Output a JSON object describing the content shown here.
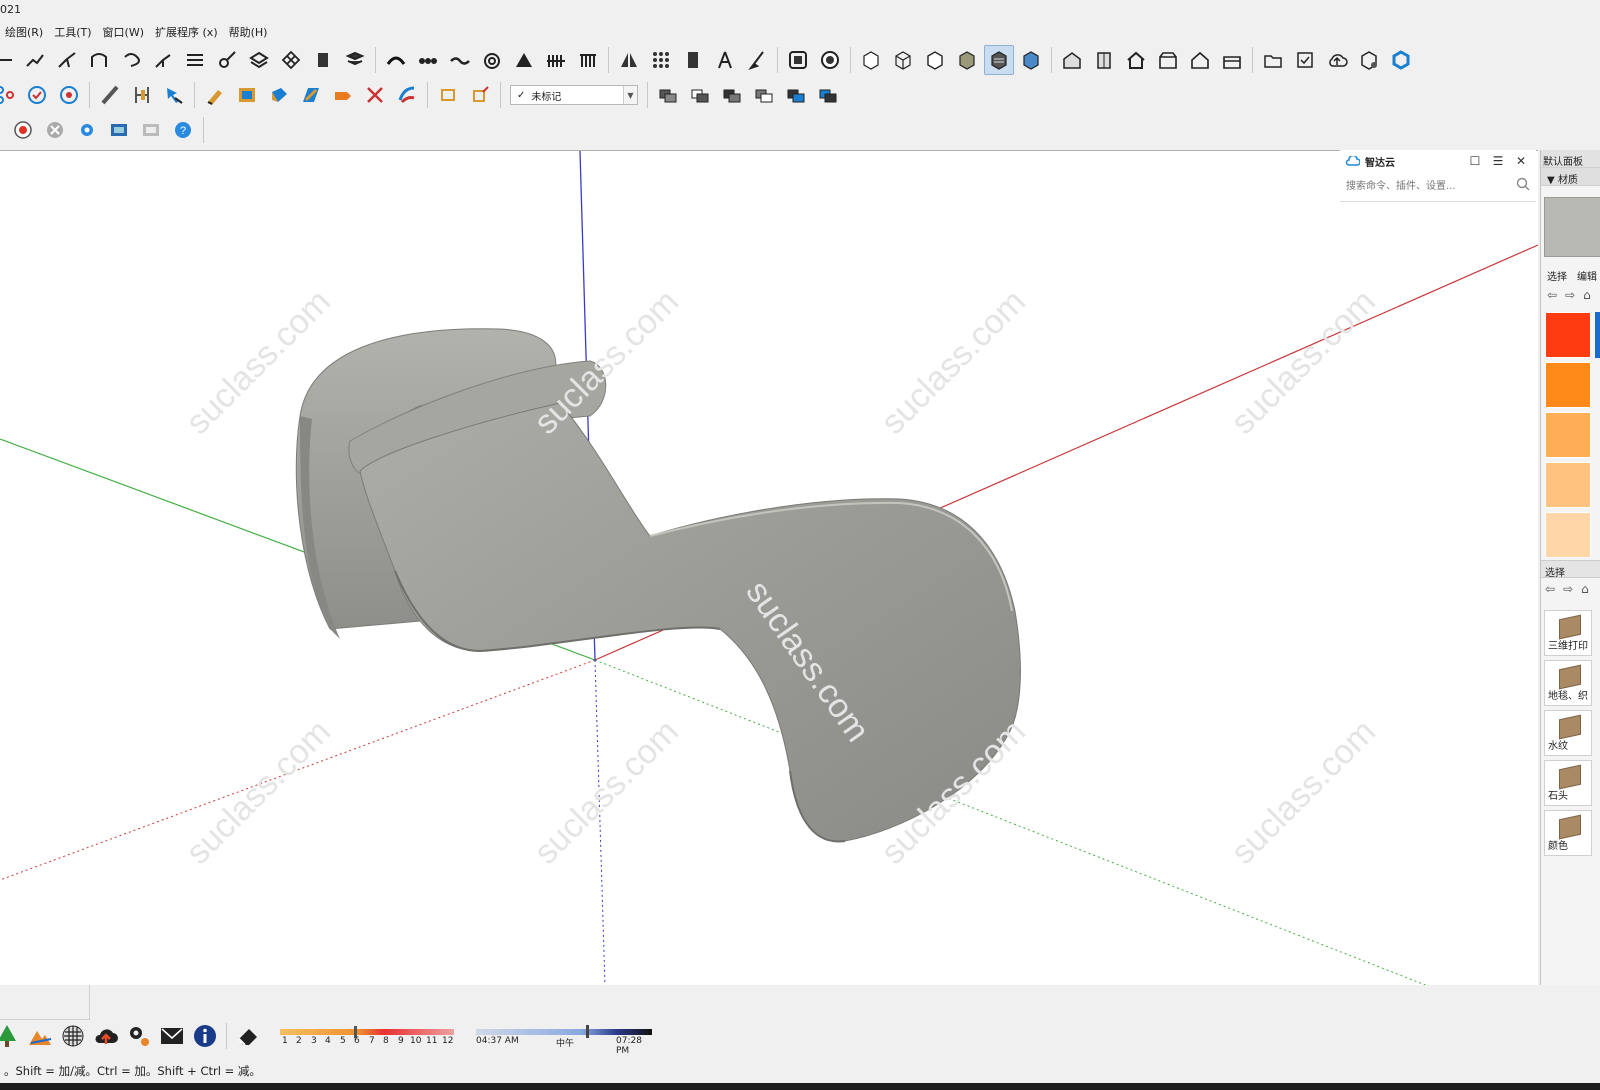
{
  "window": {
    "title_fragment": "021"
  },
  "menu": [
    "绘图(R)",
    "工具(T)",
    "窗口(W)",
    "扩展程序 (x)",
    "帮助(H)"
  ],
  "tag_dropdown": {
    "value": "未标记",
    "check": "✓"
  },
  "plugin": {
    "name": "智达云",
    "search_placeholder": "搜索命令、插件、设置..."
  },
  "default_panel": {
    "title": "默认面板",
    "section": "▼ 材质",
    "tab_select": "选择",
    "tab_edit": "编辑",
    "section2": "选择"
  },
  "materials": [
    {
      "label": "三维打印"
    },
    {
      "label": "地毯、织"
    },
    {
      "label": "水纹"
    },
    {
      "label": "石头"
    },
    {
      "label": "颜色"
    }
  ],
  "color_swatches": [
    "#ff3b12",
    "#ff8a1a",
    "#ffae55",
    "#ffc37f",
    "#ffd6a8"
  ],
  "watermark": "suclass.com",
  "shadow_months": [
    "1",
    "2",
    "3",
    "4",
    "5",
    "6",
    "7",
    "8",
    "9",
    "10",
    "11",
    "12"
  ],
  "time_strip": {
    "start": "04:37 AM",
    "mid": "中午",
    "end": "07:28 PM"
  },
  "status_text": "。Shift = 加/减。Ctrl = 加。Shift + Ctrl = 减。",
  "colors": {
    "axis_red": "#c8383a",
    "axis_green": "#3fae3f",
    "axis_blue": "#3a3ac8",
    "fabric": "#9a9a96"
  }
}
